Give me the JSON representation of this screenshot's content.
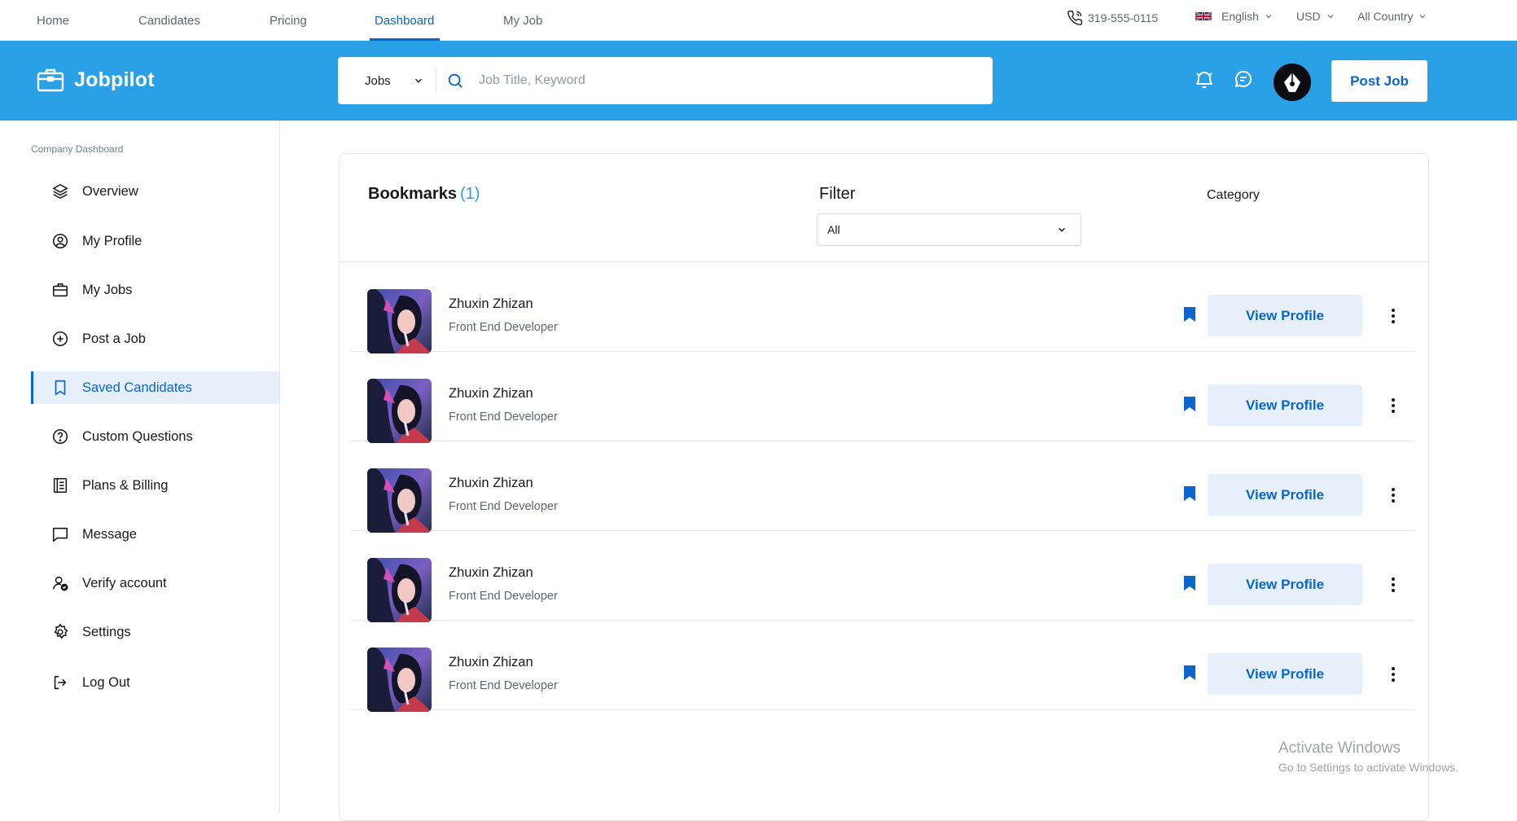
{
  "topnav": {
    "links": [
      "Home",
      "Candidates",
      "Pricing",
      "Dashboard",
      "My Job"
    ],
    "active": "Dashboard",
    "phone": "319-555-0115",
    "language": "English",
    "currency": "USD",
    "country": "All Country"
  },
  "header": {
    "logo_text": "Jobpilot",
    "search_type": "Jobs",
    "search_placeholder": "Job Title, Keyword",
    "post_job_label": "Post Job"
  },
  "sidebar": {
    "section_title": "Company Dashboard",
    "items": [
      {
        "label": "Overview",
        "icon": "layers-icon"
      },
      {
        "label": "My Profile",
        "icon": "user-circle-icon"
      },
      {
        "label": "My Jobs",
        "icon": "briefcase-icon"
      },
      {
        "label": "Post a Job",
        "icon": "plus-circle-icon"
      },
      {
        "label": "Saved Candidates",
        "icon": "bookmark-icon",
        "active": true
      },
      {
        "label": "Custom Questions",
        "icon": "question-circle-icon"
      },
      {
        "label": "Plans & Billing",
        "icon": "billing-icon"
      },
      {
        "label": "Message",
        "icon": "message-icon"
      },
      {
        "label": "Verify account",
        "icon": "verify-user-icon"
      },
      {
        "label": "Settings",
        "icon": "gear-icon"
      },
      {
        "label": "Log Out",
        "icon": "logout-icon"
      }
    ]
  },
  "main": {
    "title": "Bookmarks",
    "count": "(1)",
    "filter_label": "Filter",
    "filter_value": "All",
    "category_label": "Category",
    "view_profile_label": "View Profile",
    "candidates": [
      {
        "name": "Zhuxin Zhizan",
        "role": "Front End Developer"
      },
      {
        "name": "Zhuxin Zhizan",
        "role": "Front End Developer"
      },
      {
        "name": "Zhuxin Zhizan",
        "role": "Front End Developer"
      },
      {
        "name": "Zhuxin Zhizan",
        "role": "Front End Developer"
      },
      {
        "name": "Zhuxin Zhizan",
        "role": "Front End Developer"
      }
    ]
  },
  "watermark": {
    "line1": "Activate Windows",
    "line2": "Go to Settings to activate Windows."
  },
  "colors": {
    "brand_blue": "#2aa1e6",
    "primary": "#0a65cc",
    "active_bg": "#e7f0fa"
  }
}
